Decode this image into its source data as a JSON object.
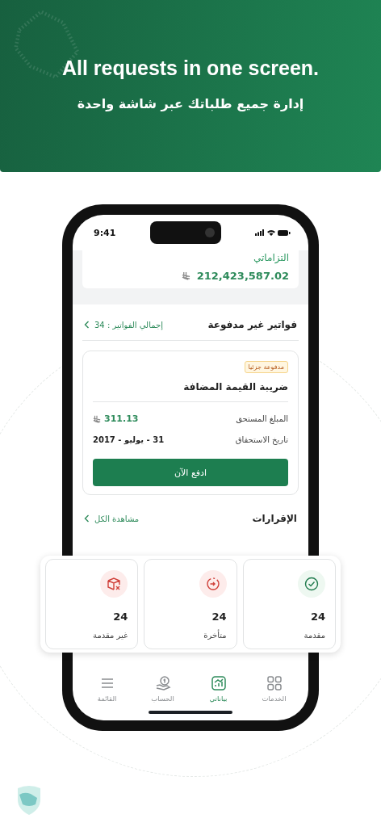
{
  "hero": {
    "title": "All requests in one screen.",
    "subtitle": "إدارة جميع طلباتك عبر شاشة واحدة"
  },
  "status_bar": {
    "time": "9:41"
  },
  "balance": {
    "label": "التزاماتي",
    "amount": "212,423,587.02"
  },
  "invoices": {
    "title": "فواتير غير مدفوعة",
    "total": "إجمالي الفواتير : 34"
  },
  "invoice_card": {
    "badge": "مدفوعة جزئيا",
    "name": "ضريبة القيمة المضافة",
    "rows": [
      {
        "label": "المبلغ المستحق",
        "value": "311.13",
        "kind": "amount"
      },
      {
        "label": "تاريخ الاستحقاق",
        "value": "31 - يوليو - 2017",
        "kind": "date"
      }
    ],
    "button": "ادفع الآن"
  },
  "declarations": {
    "title": "الإقرارات",
    "link": "مشاهدة الكل"
  },
  "stats": [
    {
      "label": "مقدمة",
      "count": "24",
      "kind": "submitted"
    },
    {
      "label": "متأخرة",
      "count": "24",
      "kind": "late"
    },
    {
      "label": "غير مقدمة",
      "count": "24",
      "kind": "missing"
    }
  ],
  "tab_bar": [
    {
      "label": "الخدمات",
      "kind": "grid",
      "selected": false
    },
    {
      "label": "بياناتي",
      "kind": "chart",
      "selected": true
    },
    {
      "label": "الحساب",
      "kind": "coin",
      "selected": false
    },
    {
      "label": "القائمة",
      "kind": "menu",
      "selected": false
    }
  ]
}
